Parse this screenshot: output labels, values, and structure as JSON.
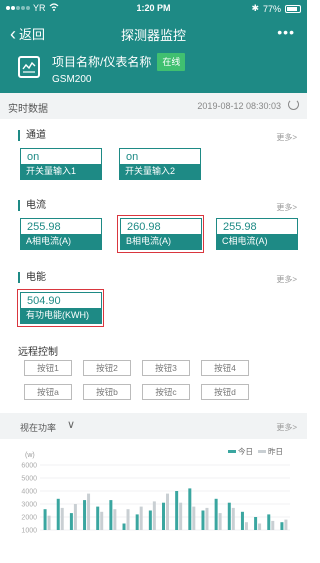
{
  "status_bar": {
    "carrier": "YR",
    "time": "1:20 PM",
    "battery": "77%"
  },
  "nav": {
    "back_label": "返回",
    "title": "探测器监控",
    "more": "•••"
  },
  "device": {
    "name": "项目名称/仪表名称",
    "status": "在线",
    "model": "GSM200"
  },
  "realtime": {
    "title": "实时数据",
    "timestamp": "2019-08-12 08:30:03"
  },
  "sections": {
    "channel": {
      "title": "通道",
      "more": "更多>",
      "cards": [
        {
          "value": "on",
          "label": "开关量输入1"
        },
        {
          "value": "on",
          "label": "开关量输入2"
        }
      ]
    },
    "current": {
      "title": "电流",
      "more": "更多>",
      "cards": [
        {
          "value": "255.98",
          "label": "A相电流(A)"
        },
        {
          "value": "260.98",
          "label": "B相电流(A)"
        },
        {
          "value": "255.98",
          "label": "C相电流(A)"
        }
      ]
    },
    "energy": {
      "title": "电能",
      "more": "更多>",
      "cards": [
        {
          "value": "504.90",
          "label": "有功电能(KWH)"
        }
      ]
    }
  },
  "remote": {
    "title": "远程控制",
    "buttons": [
      "按钮1",
      "按钮2",
      "按钮3",
      "按钮4",
      "按钮a",
      "按钮b",
      "按钮c",
      "按钮d"
    ]
  },
  "power": {
    "title": "视在功率",
    "more": "更多>"
  },
  "colors": {
    "primary": "#1e8a85",
    "highlight": "#d9363e",
    "online": "#40c070",
    "today": "#3aa6a0",
    "yesterday": "#c9cfd3"
  },
  "chart_data": {
    "type": "bar",
    "ylabel": "(w)",
    "yticks": [
      1000,
      2000,
      3000,
      4000,
      5000,
      6000
    ],
    "ylim": [
      1000,
      6000
    ],
    "grid": true,
    "legend_position": "top-right",
    "series": [
      {
        "name": "今日",
        "values": [
          2600,
          3400,
          2300,
          3300,
          2800,
          3300,
          1500,
          2200,
          2500,
          3100,
          4000,
          4200,
          2500,
          3400,
          3100,
          2400,
          2000,
          2200,
          1600
        ]
      },
      {
        "name": "昨日",
        "values": [
          2100,
          2700,
          3000,
          3800,
          2400,
          2600,
          2600,
          2800,
          3200,
          3800,
          3100,
          2800,
          2700,
          2300,
          2700,
          1600,
          1500,
          1700,
          1800
        ]
      }
    ]
  }
}
